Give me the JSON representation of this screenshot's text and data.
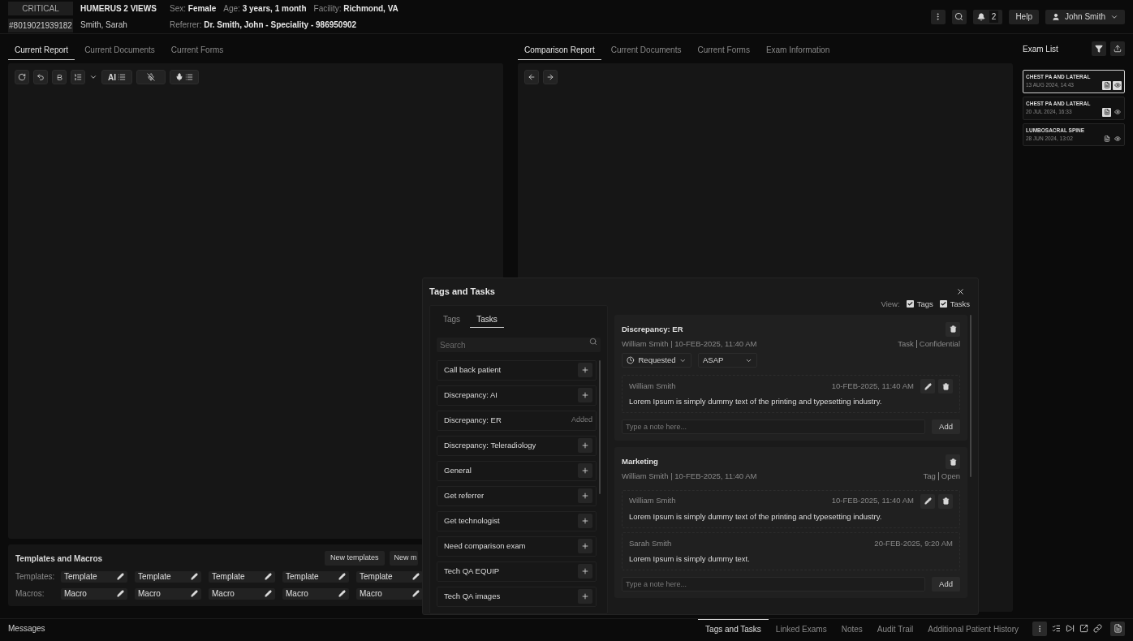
{
  "header": {
    "priority": "CRITICAL",
    "accession": "#8019021939182",
    "exam": "HUMERUS 2 VIEWS",
    "patient": "Smith, Sarah",
    "fields": [
      {
        "label": "Sex:",
        "value": "Female"
      },
      {
        "label": "Age:",
        "value": "3 years, 1 month"
      },
      {
        "label": "Facility:",
        "value": "Richmond, VA"
      }
    ],
    "referrer": {
      "label": "Referrer:",
      "value": "Dr. Smith, John - Speciality - 986950902"
    },
    "notifications": "2",
    "help": "Help",
    "user": "John Smith"
  },
  "left_tabs": [
    {
      "label": "Current Report",
      "selected": true
    },
    {
      "label": "Current Documents",
      "selected": false
    },
    {
      "label": "Current Forms",
      "selected": false
    }
  ],
  "editor_toolbar": {
    "ai_label": "AI"
  },
  "right_tabs": [
    {
      "label": "Comparison Report",
      "selected": true
    },
    {
      "label": "Current Documents",
      "selected": false
    },
    {
      "label": "Current Forms",
      "selected": false
    },
    {
      "label": "Exam Information",
      "selected": false
    }
  ],
  "exam_list": {
    "title": "Exam List",
    "items": [
      {
        "title": "CHEST PA AND LATERAL",
        "date": "13 AUG 2024, 14:43",
        "selected": true,
        "report_ready": true
      },
      {
        "title": "CHEST PA AND LATERAL",
        "date": "20 JUL 2024, 16:33",
        "selected": false,
        "report_ready": true
      },
      {
        "title": "LUMBOSACRAL SPINE",
        "date": "28 JUN 2024, 13:02",
        "selected": false,
        "report_ready": false
      }
    ]
  },
  "templates_panel": {
    "title": "Templates and Macros",
    "buttons": [
      "New templates",
      "New m"
    ],
    "templates_label": "Templates:",
    "templates": [
      "Template",
      "Template",
      "Template",
      "Template",
      "Template"
    ],
    "macros_label": "Macros:",
    "macros": [
      "Macro",
      "Macro",
      "Macro",
      "Macro",
      "Macro"
    ]
  },
  "messages": "Messages",
  "bottom_tabs": [
    {
      "label": "Tags and Tasks",
      "selected": true
    },
    {
      "label": "Linked Exams",
      "selected": false
    },
    {
      "label": "Notes",
      "selected": false
    },
    {
      "label": "Audit Trail",
      "selected": false
    },
    {
      "label": "Additional Patient History",
      "selected": false
    }
  ],
  "modal": {
    "title": "Tags and Tasks",
    "tabs": [
      {
        "label": "Tags",
        "selected": false
      },
      {
        "label": "Tasks",
        "selected": true
      }
    ],
    "search": {
      "placeholder": "Search"
    },
    "tasks": [
      {
        "label": "Call back patient"
      },
      {
        "label": "Discrepancy: AI"
      },
      {
        "label": "Discrepancy: ER",
        "status": "Added"
      },
      {
        "label": "Discrepancy: Teleradiology"
      },
      {
        "label": "General"
      },
      {
        "label": "Get referrer"
      },
      {
        "label": "Get technologist"
      },
      {
        "label": "Need comparison exam"
      },
      {
        "label": "Tech QA EQUIP"
      },
      {
        "label": "Tech QA images"
      }
    ],
    "view": {
      "label": "View:",
      "options": [
        {
          "label": "Tags",
          "checked": true
        },
        {
          "label": "Tasks",
          "checked": true
        }
      ]
    },
    "cards": [
      {
        "title": "Discrepancy: ER",
        "meta": "William Smith | 10-FEB-2025, 11:40 AM",
        "type": "Task",
        "status": "Confidential",
        "state_select": "Requested",
        "priority_select": "ASAP",
        "notes": [
          {
            "author": "William Smith",
            "date": "10-FEB-2025, 11:40 AM",
            "text": "Lorem Ipsum is simply dummy text of the printing and typesetting industry.",
            "editable": true
          }
        ],
        "note_placeholder": "Type a note here...",
        "add": "Add"
      },
      {
        "title": "Marketing",
        "meta": "William Smith | 10-FEB-2025, 11:40 AM",
        "type": "Tag",
        "status": "Open",
        "notes": [
          {
            "author": "William Smith",
            "date": "10-FEB-2025, 11:40 AM",
            "text": "Lorem Ipsum is simply dummy text of the printing and typesetting industry.",
            "editable": true
          },
          {
            "author": "Sarah Smith",
            "date": "20-FEB-2025, 9:20 AM",
            "text": "Lorem Ipsum is simply dummy text.",
            "editable": false
          }
        ],
        "note_placeholder": "Type a note here...",
        "add": "Add"
      }
    ]
  }
}
